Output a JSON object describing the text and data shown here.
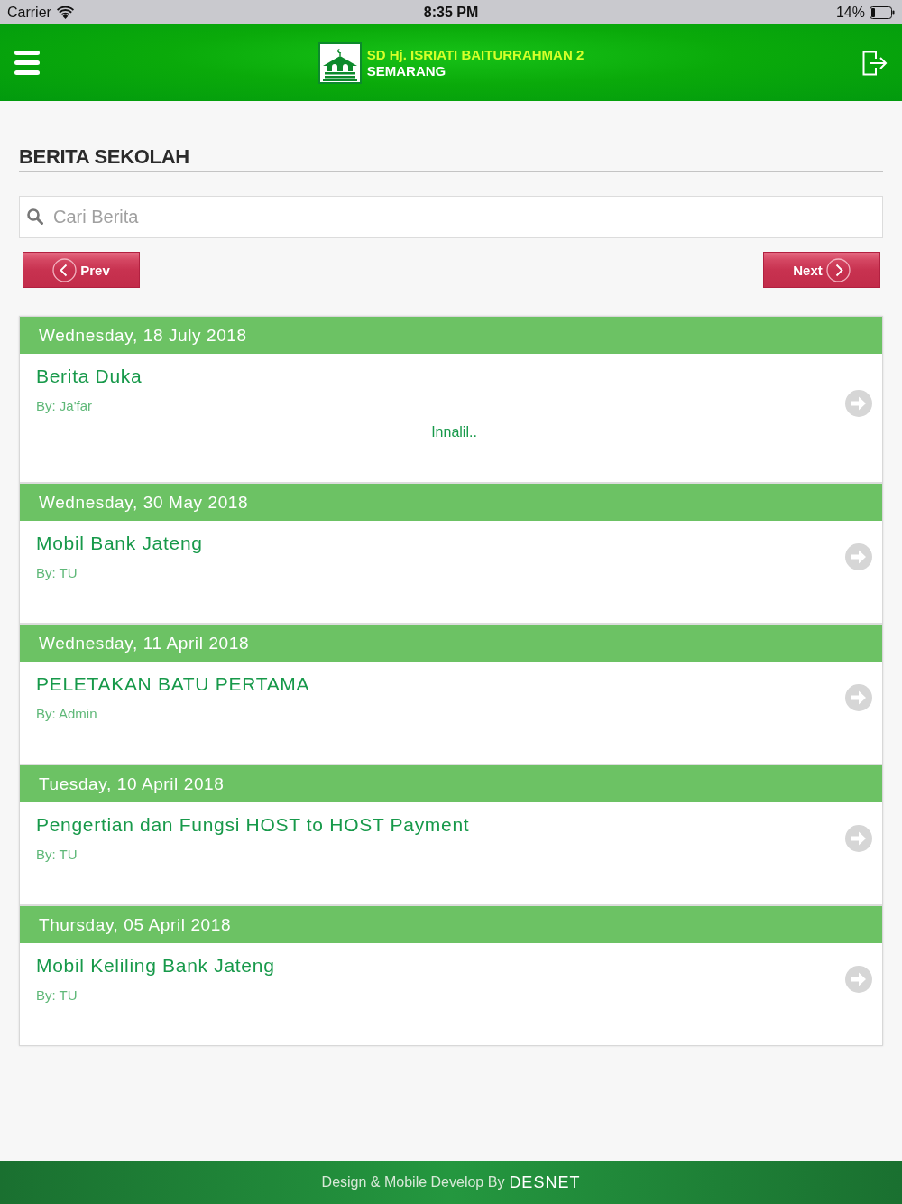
{
  "status_bar": {
    "carrier": "Carrier",
    "time": "8:35 PM",
    "battery": "14%"
  },
  "header": {
    "school_name": "SD Hj. ISRIATI BAITURRAHMAN 2",
    "city": "SEMARANG"
  },
  "page_title": "BERITA SEKOLAH",
  "search": {
    "placeholder": "Cari Berita"
  },
  "pagination": {
    "prev": "Prev",
    "next": "Next"
  },
  "news": [
    {
      "date": "Wednesday, 18 July 2018",
      "title": "Berita Duka",
      "author": "By: Ja'far",
      "excerpt": "Innalil.."
    },
    {
      "date": "Wednesday, 30 May 2018",
      "title": "Mobil Bank Jateng",
      "author": "By: TU"
    },
    {
      "date": "Wednesday, 11 April 2018",
      "title": "PELETAKAN BATU PERTAMA",
      "author": "By: Admin"
    },
    {
      "date": "Tuesday, 10 April 2018",
      "title": "Pengertian dan Fungsi HOST to HOST Payment",
      "author": "By: TU"
    },
    {
      "date": "Thursday, 05 April 2018",
      "title": "Mobil Keliling Bank Jateng",
      "author": "By: TU"
    }
  ],
  "footer": {
    "text": "Design & Mobile Develop By",
    "brand": "DESNET"
  }
}
